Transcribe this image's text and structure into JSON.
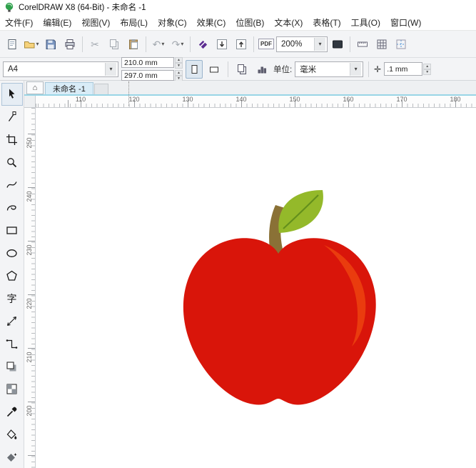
{
  "window": {
    "title": "CorelDRAW X8 (64-Bit) - 未命名 -1"
  },
  "menu": {
    "items": [
      {
        "label": "文件(F)"
      },
      {
        "label": "编辑(E)"
      },
      {
        "label": "视图(V)"
      },
      {
        "label": "布局(L)"
      },
      {
        "label": "对象(C)"
      },
      {
        "label": "效果(C)"
      },
      {
        "label": "位图(B)"
      },
      {
        "label": "文本(X)"
      },
      {
        "label": "表格(T)"
      },
      {
        "label": "工具(O)"
      },
      {
        "label": "窗口(W)"
      }
    ]
  },
  "toolbar": {
    "zoom_level": "200%",
    "pdf_label": "PDF"
  },
  "property_bar": {
    "page_size": "A4",
    "page_width": "210.0 mm",
    "page_height": "297.0 mm",
    "units_label": "单位:",
    "units_value": "毫米",
    "nudge_value": ".1 mm"
  },
  "tabbar": {
    "document_tab": "未命名 -1"
  },
  "rulers": {
    "horizontal_labels": [
      "110",
      "120",
      "130",
      "140",
      "150",
      "160",
      "170",
      "180"
    ],
    "vertical_labels": [
      "250",
      "240",
      "230",
      "220",
      "210",
      "200"
    ]
  },
  "toolbox": {
    "text_tool_glyph": "字"
  },
  "icons": {
    "caret_down": "▾",
    "spin_up": "▲",
    "spin_down": "▼",
    "undo": "↶",
    "redo": "↷",
    "cut": "✂",
    "home": "⌂",
    "nudge": "✛"
  },
  "canvas": {
    "apple": {
      "body_color": "#d9150a",
      "highlight_color": "#ea3c0e",
      "leaf_color": "#94b92a",
      "leaf_vein_color": "#64901c",
      "stem_color": "#8a7136"
    }
  }
}
